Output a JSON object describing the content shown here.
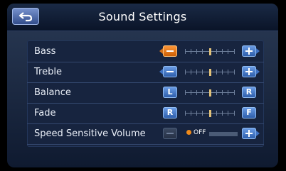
{
  "header": {
    "title": "Sound Settings"
  },
  "rows": [
    {
      "label": "Bass",
      "dec": "−",
      "inc": "+",
      "dec_active": true
    },
    {
      "label": "Treble",
      "dec": "−",
      "inc": "+"
    },
    {
      "label": "Balance",
      "dec": "L",
      "inc": "R"
    },
    {
      "label": "Fade",
      "dec": "R",
      "inc": "F"
    },
    {
      "label": "Speed Sensitive Volume",
      "state": "OFF"
    }
  ]
}
